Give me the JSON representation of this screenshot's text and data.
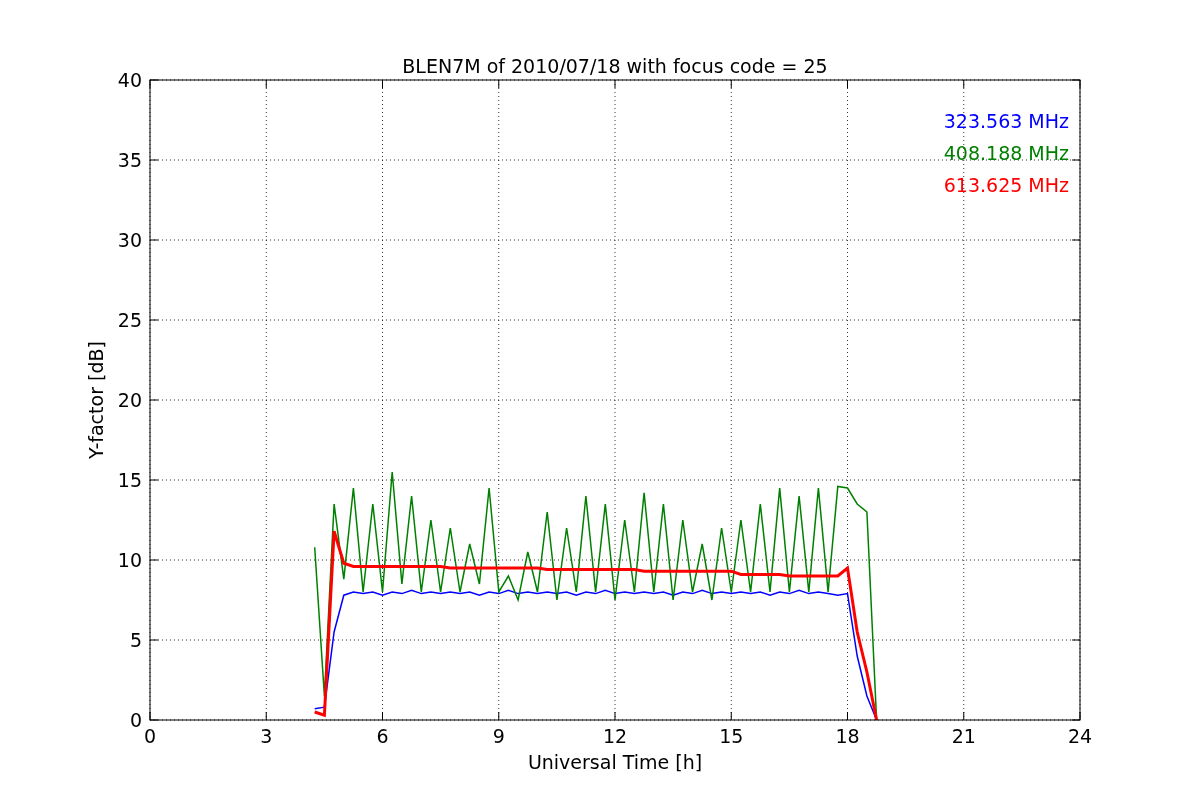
{
  "chart_data": {
    "type": "line",
    "title": "BLEN7M of 2010/07/18 with focus code = 25",
    "xlabel": "Universal Time [h]",
    "ylabel": "Y-factor [dB]",
    "x": [
      4.25,
      4.5,
      4.75,
      5,
      5.25,
      5.5,
      5.75,
      6,
      6.25,
      6.5,
      6.75,
      7,
      7.25,
      7.5,
      7.75,
      8,
      8.25,
      8.5,
      8.75,
      9,
      9.25,
      9.5,
      9.75,
      10,
      10.25,
      10.5,
      10.75,
      11,
      11.25,
      11.5,
      11.75,
      12,
      12.25,
      12.5,
      12.75,
      13,
      13.25,
      13.5,
      13.75,
      14,
      14.25,
      14.5,
      14.75,
      15,
      15.25,
      15.5,
      15.75,
      16,
      16.25,
      16.5,
      16.75,
      17,
      17.25,
      17.5,
      17.75,
      18,
      18.25,
      18.5,
      18.75
    ],
    "series": [
      {
        "name": "323.563 MHz",
        "color": "#0000ff",
        "values": [
          0.7,
          0.8,
          5.5,
          7.8,
          8.0,
          7.9,
          8.0,
          7.8,
          8.0,
          7.9,
          8.1,
          7.9,
          8.0,
          7.9,
          8.0,
          7.9,
          8.0,
          7.8,
          8.0,
          7.9,
          8.1,
          7.9,
          8.0,
          7.9,
          8.0,
          7.9,
          8.0,
          7.8,
          8.0,
          7.9,
          8.1,
          7.9,
          8.0,
          7.9,
          8.0,
          7.9,
          8.0,
          7.8,
          8.0,
          7.9,
          8.1,
          7.9,
          8.0,
          7.9,
          8.0,
          7.9,
          8.0,
          7.8,
          8.0,
          7.9,
          8.1,
          7.9,
          8.0,
          7.9,
          7.8,
          7.9,
          4.0,
          1.5,
          0
        ]
      },
      {
        "name": "408.188 MHz",
        "color": "#008000",
        "values": [
          10.8,
          1.5,
          13.5,
          8.8,
          14.5,
          8,
          13.5,
          8,
          15.5,
          8.5,
          14,
          8,
          12.5,
          8,
          12,
          8,
          11,
          8.5,
          14.5,
          8,
          9,
          7.5,
          10.5,
          8,
          13,
          7.5,
          12,
          8,
          14,
          8,
          13.5,
          7.5,
          12.5,
          8,
          14.2,
          8,
          13.5,
          7.5,
          12.5,
          8,
          11,
          7.5,
          12,
          8,
          12.5,
          8,
          13.5,
          8,
          14.5,
          8,
          14,
          8,
          14.5,
          8,
          14.6,
          14.5,
          13.5,
          13,
          0
        ]
      },
      {
        "name": "613.625 MHz",
        "color": "#ff0000",
        "values": [
          0.5,
          0.3,
          11.8,
          9.8,
          9.6,
          9.6,
          9.6,
          9.6,
          9.6,
          9.6,
          9.6,
          9.6,
          9.6,
          9.6,
          9.5,
          9.5,
          9.5,
          9.5,
          9.5,
          9.5,
          9.5,
          9.5,
          9.5,
          9.5,
          9.4,
          9.4,
          9.4,
          9.4,
          9.4,
          9.4,
          9.4,
          9.4,
          9.4,
          9.4,
          9.3,
          9.3,
          9.3,
          9.3,
          9.3,
          9.3,
          9.3,
          9.3,
          9.3,
          9.3,
          9.1,
          9.1,
          9.1,
          9.1,
          9.1,
          9.0,
          9.0,
          9.0,
          9.0,
          9.0,
          9.0,
          9.5,
          5.5,
          3.0,
          0
        ]
      }
    ],
    "grid": true,
    "xlim": [
      0,
      24
    ],
    "ylim": [
      0,
      40
    ],
    "xticks": [
      0,
      3,
      6,
      9,
      12,
      15,
      18,
      21,
      24
    ],
    "yticks": [
      0,
      5,
      10,
      15,
      20,
      25,
      30,
      35,
      40
    ]
  }
}
